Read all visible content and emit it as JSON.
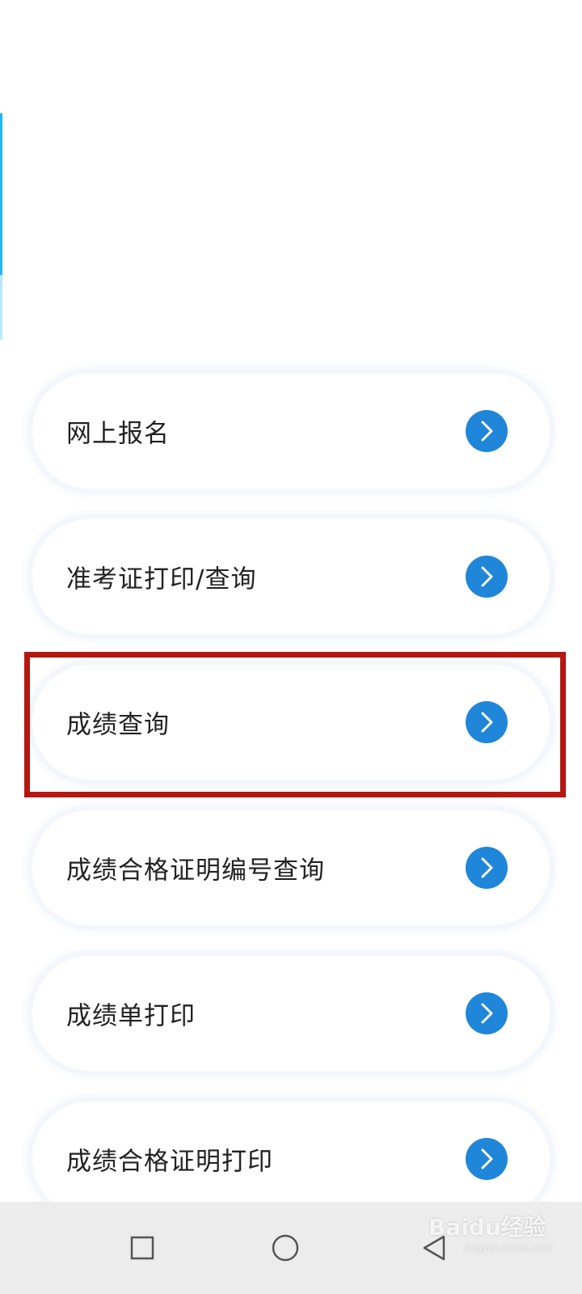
{
  "menu": {
    "items": [
      {
        "label": "网上报名"
      },
      {
        "label": "准考证打印/查询"
      },
      {
        "label": "成绩查询"
      },
      {
        "label": "成绩合格证明编号查询"
      },
      {
        "label": "成绩单打印"
      },
      {
        "label": "成绩合格证明打印"
      }
    ],
    "highlighted_index": 2
  },
  "colors": {
    "accent": "#1f86d9",
    "highlight_border": "#b51711",
    "edge_bar": "#21b6f0",
    "nav_bar": "#ececec"
  },
  "icons": {
    "item_arrow": "chevron-right-icon",
    "nav_recent": "square-icon",
    "nav_home": "circle-icon",
    "nav_back": "triangle-back-icon"
  },
  "watermark": {
    "text": "Baidu经验",
    "sub": "jingyan.baidu.com"
  }
}
